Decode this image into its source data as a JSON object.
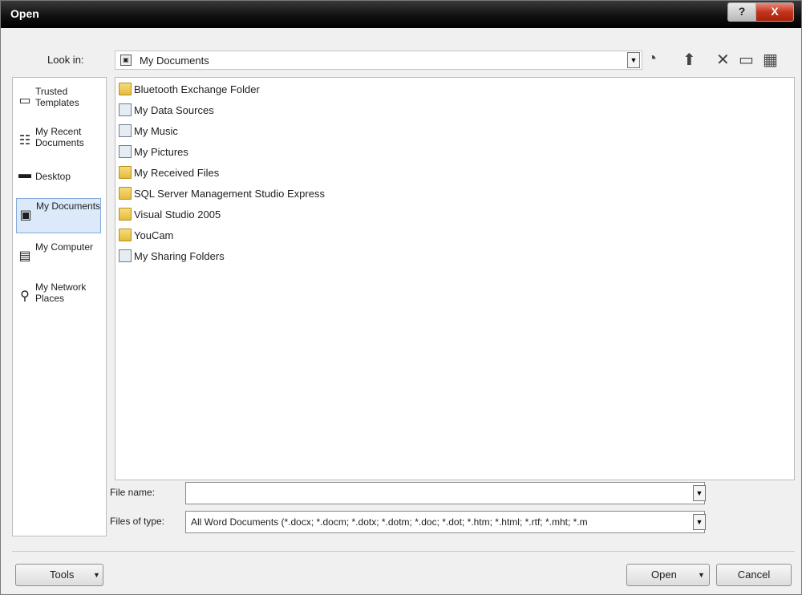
{
  "window": {
    "title": "Open"
  },
  "titlebar": {
    "help_label": "?",
    "close_label": "X"
  },
  "lookin": {
    "label": "Look in:",
    "value": "My Documents",
    "dropdown_glyph": "▼"
  },
  "toolbar": {
    "icons": [
      {
        "name": "back-icon",
        "glyph": "◔"
      },
      {
        "name": "up-folder-icon",
        "glyph": "⬆"
      },
      {
        "name": "delete-icon",
        "glyph": "✕"
      },
      {
        "name": "new-folder-icon",
        "glyph": "▭"
      },
      {
        "name": "views-icon",
        "glyph": "▦"
      }
    ]
  },
  "places": [
    {
      "name": "place-trusted-templates",
      "label": "Trusted Templates",
      "icon": "folder-icon",
      "glyph": "▭"
    },
    {
      "name": "place-my-recent-documents",
      "label": "My Recent Documents",
      "icon": "recent-documents-icon",
      "glyph": "☷"
    },
    {
      "name": "place-desktop",
      "label": "Desktop",
      "icon": "desktop-icon",
      "glyph": "▬"
    },
    {
      "name": "place-my-documents",
      "label": "My Documents",
      "icon": "my-documents-icon",
      "glyph": "▣"
    },
    {
      "name": "place-my-computer",
      "label": "My Computer",
      "icon": "computer-icon",
      "glyph": "▤"
    },
    {
      "name": "place-my-network-places",
      "label": "My Network Places",
      "icon": "network-icon",
      "glyph": "⚲"
    }
  ],
  "files": [
    {
      "label": "Bluetooth Exchange Folder",
      "kind": "folder"
    },
    {
      "label": "My Data Sources",
      "kind": "special"
    },
    {
      "label": "My Music",
      "kind": "special"
    },
    {
      "label": "My Pictures",
      "kind": "special"
    },
    {
      "label": "My Received Files",
      "kind": "folder"
    },
    {
      "label": "SQL Server Management Studio Express",
      "kind": "folder"
    },
    {
      "label": "Visual Studio 2005",
      "kind": "folder"
    },
    {
      "label": "YouCam",
      "kind": "folder"
    },
    {
      "label": "My Sharing Folders",
      "kind": "special"
    }
  ],
  "filename": {
    "label": "File name:",
    "value": ""
  },
  "filetype": {
    "label": "Files of type:",
    "value": "All Word Documents (*.docx; *.docm; *.dotx; *.dotm; *.doc; *.dot; *.htm; *.html; *.rtf; *.mht; *.m"
  },
  "buttons": {
    "tools": "Tools",
    "open": "Open",
    "cancel": "Cancel",
    "arrow": "▼"
  },
  "colors": {
    "title_bar": "#000000",
    "selection": "#dbe9fb",
    "close_button": "#c2351d"
  }
}
